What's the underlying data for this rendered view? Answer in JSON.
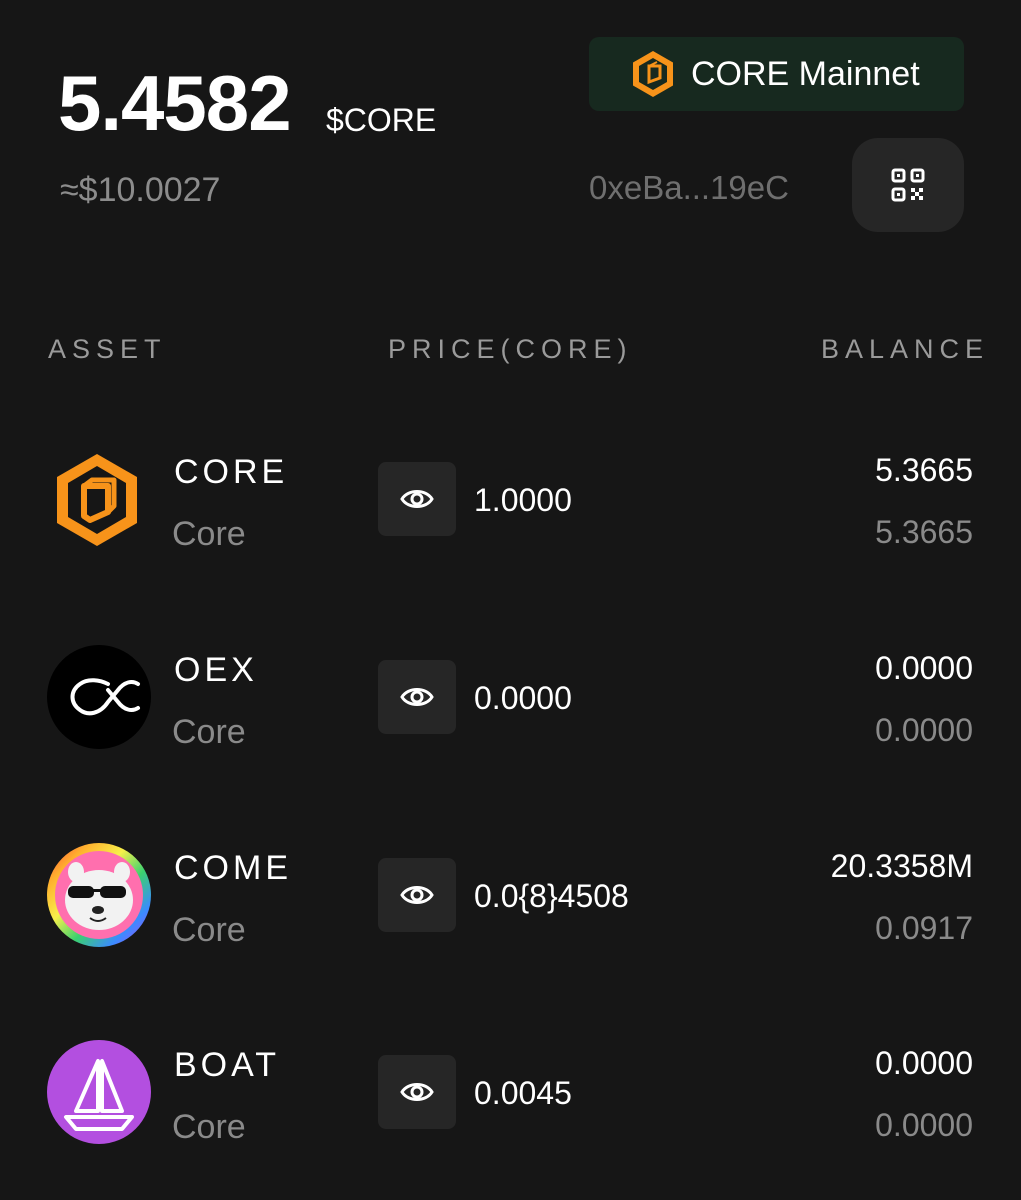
{
  "header": {
    "balance": "5.4582",
    "unit": "$CORE",
    "usd_value": "≈$10.0027",
    "network_label": "CORE Mainnet",
    "address": "0xeBa...19eC",
    "qr_icon": "qr-code-icon"
  },
  "columns": {
    "asset": "ASSET",
    "price": "PRICE(CORE)",
    "balance": "BALANCE"
  },
  "tokens": [
    {
      "symbol": "CORE",
      "chain": "Core",
      "price": "1.0000",
      "balance": "5.3665",
      "value": "5.3665",
      "logo": "core-hexagon-logo"
    },
    {
      "symbol": "OEX",
      "chain": "Core",
      "price": "0.0000",
      "balance": "0.0000",
      "value": "0.0000",
      "logo": "oex-logo"
    },
    {
      "symbol": "COME",
      "chain": "Core",
      "price": "0.0{8}4508",
      "balance": "20.3358M",
      "value": "0.0917",
      "logo": "come-dog-logo"
    },
    {
      "symbol": "BOAT",
      "chain": "Core",
      "price": "0.0045",
      "balance": "0.0000",
      "value": "0.0000",
      "logo": "boat-logo"
    }
  ],
  "colors": {
    "background": "#161616",
    "accent_orange": "#f7931a",
    "network_bg": "#17291f",
    "muted_text": "#8a8a8a",
    "boat_purple": "#b34fe0"
  }
}
